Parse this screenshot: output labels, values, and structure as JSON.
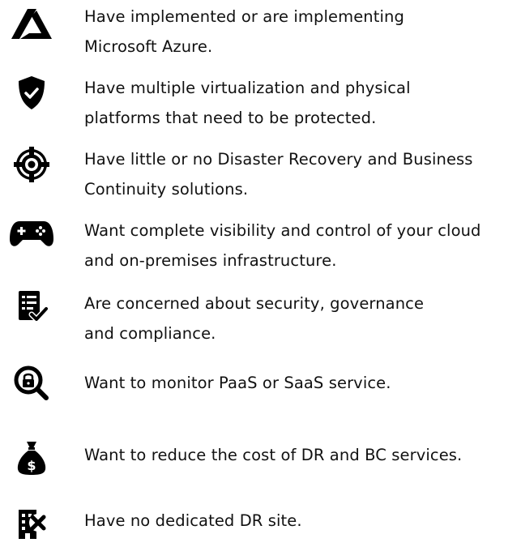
{
  "colors": {
    "icon": "#000000",
    "text": "#111111",
    "background": "#ffffff"
  },
  "items": [
    {
      "icon": "azure-logo-icon",
      "lines": [
        "Have implemented or are implementing",
        "Microsoft Azure."
      ]
    },
    {
      "icon": "shield-check-icon",
      "lines": [
        "Have multiple virtualization and physical",
        "platforms that need to be protected."
      ]
    },
    {
      "icon": "life-ring-icon",
      "lines": [
        "Have little or no Disaster Recovery and Business",
        "Continuity solutions."
      ]
    },
    {
      "icon": "gamepad-icon",
      "lines": [
        "Want complete visibility and control of your cloud",
        "and on-premises infrastructure."
      ]
    },
    {
      "icon": "checklist-icon",
      "lines": [
        "Are concerned about security, governance",
        "and compliance."
      ]
    },
    {
      "icon": "search-lock-icon",
      "lines": [
        "Want to monitor PaaS or SaaS service."
      ]
    },
    {
      "icon": "money-bag-icon",
      "lines": [
        "Want to reduce the cost of DR and BC services."
      ]
    },
    {
      "icon": "building-x-icon",
      "lines": [
        "Have no dedicated DR site."
      ]
    }
  ]
}
